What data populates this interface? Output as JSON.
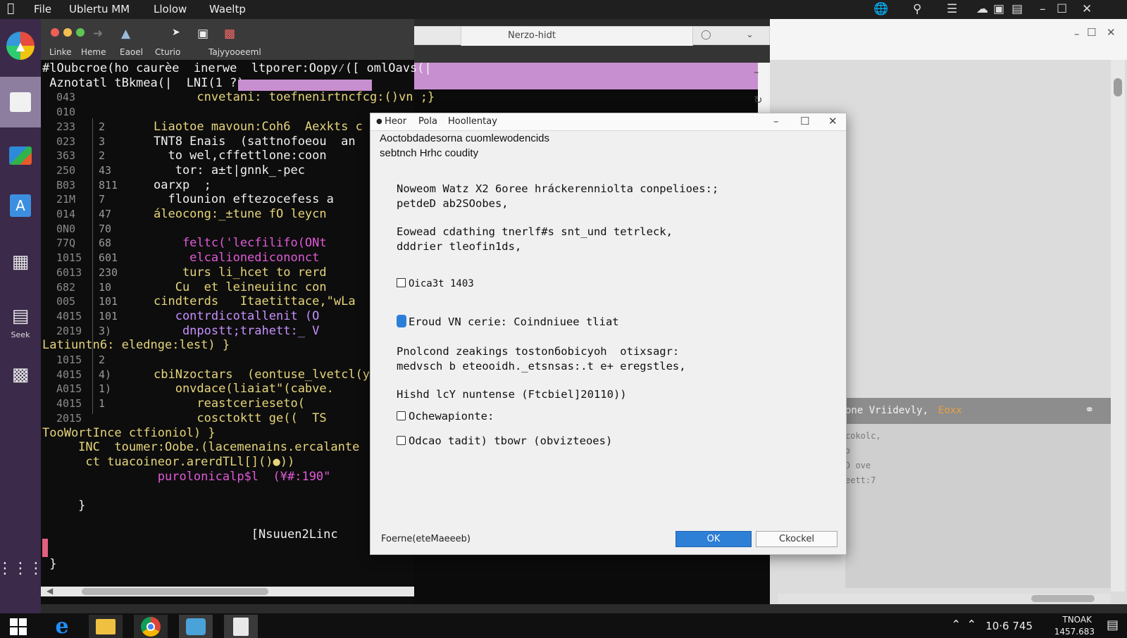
{
  "menubar": {
    "items": [
      "File",
      "Ublertu  MM",
      "Llolow",
      "Waeltp"
    ]
  },
  "launcher": {
    "seek_label": "Seek"
  },
  "editor": {
    "toolbar_labels": [
      "Linke",
      "Heme",
      "Eaoel",
      "Cturio",
      "Tajyyooeeml"
    ],
    "code_lines": [
      {
        "a": "",
        "b": "",
        "text": "#lOubcroe(ho caurèe  inerwe  ltporer:Oopy⁄([ omlOavs(|",
        "color": "#f0f0f0"
      },
      {
        "a": "",
        "b": "",
        "text": " Aznotatl tBkmea(|  LNI(1 ?)",
        "color": "#f0f0f0"
      },
      {
        "a": "043",
        "b": "",
        "text": "      cnvetani: toefnenirtncfcg:()vn ;}",
        "color": "#e6d57a"
      },
      {
        "a": "010",
        "b": "",
        "text": "",
        "color": "#e6d57a"
      },
      {
        "a": "233",
        "b": "2",
        "text": "Liaotoe mavoun:Coh6  Aexkts c",
        "color": "#e6d57a"
      },
      {
        "a": "023",
        "b": "3",
        "text": "TNT8 Enais  (sattnofoeou  an",
        "color": "#f0f0f0"
      },
      {
        "a": "363",
        "b": "2",
        "text": "  to wel,cffettlone:coon",
        "color": "#f0f0f0"
      },
      {
        "a": "250",
        "b": "43",
        "text": "   tor: a±t|gnnk_-pec",
        "color": "#f0f0f0"
      },
      {
        "a": "B03",
        "b": "811",
        "text": "oarxp  ;",
        "color": "#f0f0f0"
      },
      {
        "a": "21M",
        "b": "7",
        "text": "  flounion eftezocefess a",
        "color": "#f0f0f0"
      },
      {
        "a": "014",
        "b": "47",
        "text": "áleocong:_±tune fO leycn",
        "color": "#e6d57a"
      },
      {
        "a": "0N0",
        "b": "70",
        "text": "",
        "color": "#e6d57a"
      },
      {
        "a": "77Q",
        "b": "68",
        "text": "    feltc('lecfilifo(ONt",
        "color": "#e05ad8"
      },
      {
        "a": "1015",
        "b": "601",
        "text": "     elcalionedicononct",
        "color": "#e05ad8"
      },
      {
        "a": "6013",
        "b": "230",
        "text": "    turs li_hcet to rerd",
        "color": "#e6d57a"
      },
      {
        "a": "682",
        "b": "10",
        "text": "   Cu  et leineuiinc con",
        "color": "#e6d57a"
      },
      {
        "a": "005",
        "b": "101",
        "text": "cindterds   Itaetittace,\"wLa",
        "color": "#e6d57a"
      },
      {
        "a": "4015",
        "b": "101",
        "text": "   contrdicotallenit (O",
        "color": "#c890ff"
      },
      {
        "a": "2019",
        "b": "3)",
        "text": "    dnpostt;trahett:_ V",
        "color": "#c890ff"
      },
      {
        "a": "",
        "b": "",
        "text": "Latiuntn6: eledngе:lest) }",
        "color": "#e6d57a"
      },
      {
        "a": "1015",
        "b": "2",
        "text": "",
        "color": "#e6d57a"
      },
      {
        "a": "4015",
        "b": "4)",
        "text": "cbiNzoctars  (eontuse_lvetcl(y",
        "color": "#e6d57a"
      },
      {
        "a": "A015",
        "b": "1)",
        "text": "   onvdace(liaiat\"(cabve.",
        "color": "#e6d57a"
      },
      {
        "a": "4015",
        "b": "1",
        "text": "      reastcerieseto(",
        "color": "#e6d57a"
      },
      {
        "a": "2015",
        "b": "",
        "text": "      cosctoktt ge((  TS",
        "color": "#e6d57a"
      },
      {
        "a": "",
        "b": "",
        "text": "TooWortInce ctfioniol) }",
        "color": "#e6d57a"
      },
      {
        "a": "",
        "b": "",
        "text": "     INC  toumer:Oobe.(lacemenains.ercalante",
        "color": "#e6d57a"
      },
      {
        "a": "",
        "b": "",
        "text": "      ct tuacoineor.arerdTLl[]()●))",
        "color": "#e6d57a"
      },
      {
        "a": "",
        "b": "",
        "text": "                purolonicalp$l  (¥#:190\"",
        "color": "#e05ad8"
      },
      {
        "a": "",
        "b": "",
        "text": "",
        "color": "#e6d57a"
      },
      {
        "a": "",
        "b": "",
        "text": "     }",
        "color": "#f0f0f0"
      },
      {
        "a": "",
        "b": "",
        "text": "",
        "color": "#e6d57a"
      },
      {
        "a": "",
        "b": "",
        "text": "                             [Nsuuen2Linc",
        "color": "#f0f0f0"
      },
      {
        "a": "",
        "b": "",
        "text": "",
        "color": "#e6d57a"
      },
      {
        "a": "",
        "b": "",
        "text": " }",
        "color": "#f0f0f0"
      }
    ]
  },
  "browser": {
    "tab_title": "Nerzo-hidt"
  },
  "right_panel": {
    "header": "one Vriidevly,",
    "header_accent": "Eoxx",
    "lines": [
      "cokolc,",
      "ɔ",
      "",
      "Ɔ ove",
      "eett:7"
    ]
  },
  "dialog": {
    "title_items": [
      "Heor",
      "Pola",
      "Hoollentay"
    ],
    "line1": "Aoctobdadesorna cuomlewodencids",
    "line2": "sebtnch Hrhc coudity",
    "para1_a": "Noweom Watz X2 6oree hráckerenniolta conpelioes:;",
    "para1_b": "petdeD ab2SOobes,",
    "para2_a": "Eowead cdathing tnerlf#s snt_und tetrleck,",
    "para2_b": "dddrier tleofin1ds,",
    "checkbox1": "Oica3t 1403",
    "radio1": "Eroud VN cerie: Coindniuee tliat",
    "para3_a": "Pnolcond zeakings tostonбobicyoh  otixsagr:",
    "para3_b": "medvsch b eteooidh._etsnsas:.t e+ eregstles,",
    "misc": "Hishd lcY nuntense (Ftcbiel]20110))",
    "checkbox2": "Ochewapionte:",
    "checkbox3": "Odcao tadit) tbowr (obvizteoes)",
    "footer_label": "Foerne(eteMaeeeb)",
    "ok": "OK",
    "cancel": "Ckockel"
  },
  "taskbar": {
    "clock_a": "10·6 745",
    "clock_b": "TNOAK",
    "clock_c": "1457.683"
  }
}
